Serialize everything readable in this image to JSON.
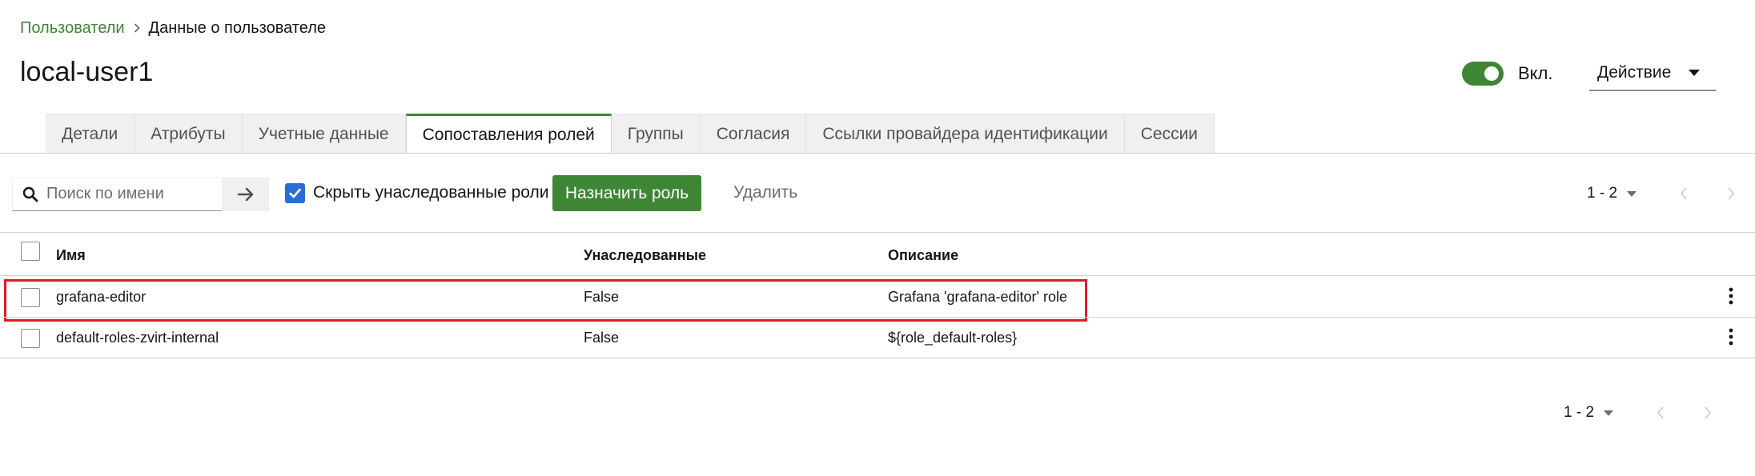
{
  "breadcrumb": {
    "parent": "Пользователи",
    "current": "Данные о пользователе"
  },
  "header": {
    "title": "local-user1",
    "enabled_label": "Вкл.",
    "enabled": true,
    "action_label": "Действие"
  },
  "tabs": [
    {
      "label": "Детали",
      "active": false
    },
    {
      "label": "Атрибуты",
      "active": false
    },
    {
      "label": "Учетные данные",
      "active": false
    },
    {
      "label": "Сопоставления ролей",
      "active": true
    },
    {
      "label": "Группы",
      "active": false
    },
    {
      "label": "Согласия",
      "active": false
    },
    {
      "label": "Ссылки провайдера идентификации",
      "active": false
    },
    {
      "label": "Сессии",
      "active": false
    }
  ],
  "toolbar": {
    "search_placeholder": "Поиск по имени",
    "search_value": "",
    "hide_inherited_label": "Скрыть унаследованные роли",
    "hide_inherited_checked": true,
    "assign_label": "Назначить роль",
    "delete_label": "Удалить"
  },
  "pagination_top": {
    "range": "1 - 2"
  },
  "pagination_bottom": {
    "range": "1 - 2"
  },
  "table": {
    "columns": [
      "Имя",
      "Унаследованные",
      "Описание"
    ],
    "rows": [
      {
        "name": "grafana-editor",
        "inherited": "False",
        "description": "Grafana 'grafana-editor' role",
        "highlighted": true
      },
      {
        "name": "default-roles-zvirt-internal",
        "inherited": "False",
        "description": "${role_default-roles}",
        "highlighted": false
      }
    ]
  },
  "colors": {
    "accent_green": "#3e8635",
    "checkbox_blue": "#2b6cd4",
    "highlight_red": "#e01b24"
  },
  "icons": {
    "breadcrumb_separator": "chevron-right-icon",
    "search": "search-icon",
    "search_submit": "arrow-right-icon",
    "checkbox": "check-icon",
    "row_actions": "kebab-menu-icon",
    "pager_prev": "chevron-left-icon",
    "pager_next": "chevron-right-icon"
  }
}
